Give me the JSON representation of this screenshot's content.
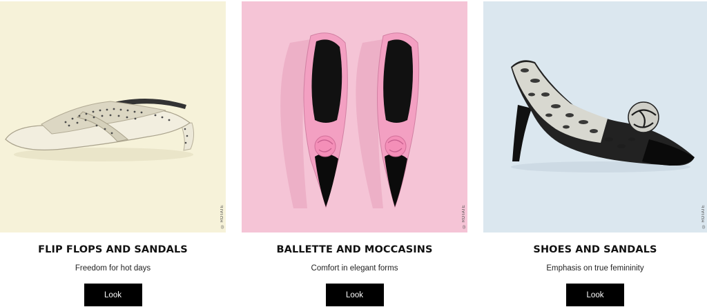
{
  "products": [
    {
      "title": "FLIP FLOPS AND SANDALS",
      "subtitle": "Freedom for hot days",
      "button": "Look",
      "credit": "© ROTATE",
      "image": "beige-sandal-photo",
      "bg": "#f6f2d8"
    },
    {
      "title": "BALLETTE AND MOCCASINS",
      "subtitle": "Comfort in elegant forms",
      "button": "Look",
      "credit": "© ROTATE",
      "image": "pink-ballet-flats-photo",
      "bg": "#f5c3d6"
    },
    {
      "title": "SHOES AND SANDALS",
      "subtitle": "Emphasis on true femininity",
      "button": "Look",
      "credit": "© ROTATE",
      "image": "snakeskin-pump-photo",
      "bg": "#dae6ee"
    }
  ]
}
